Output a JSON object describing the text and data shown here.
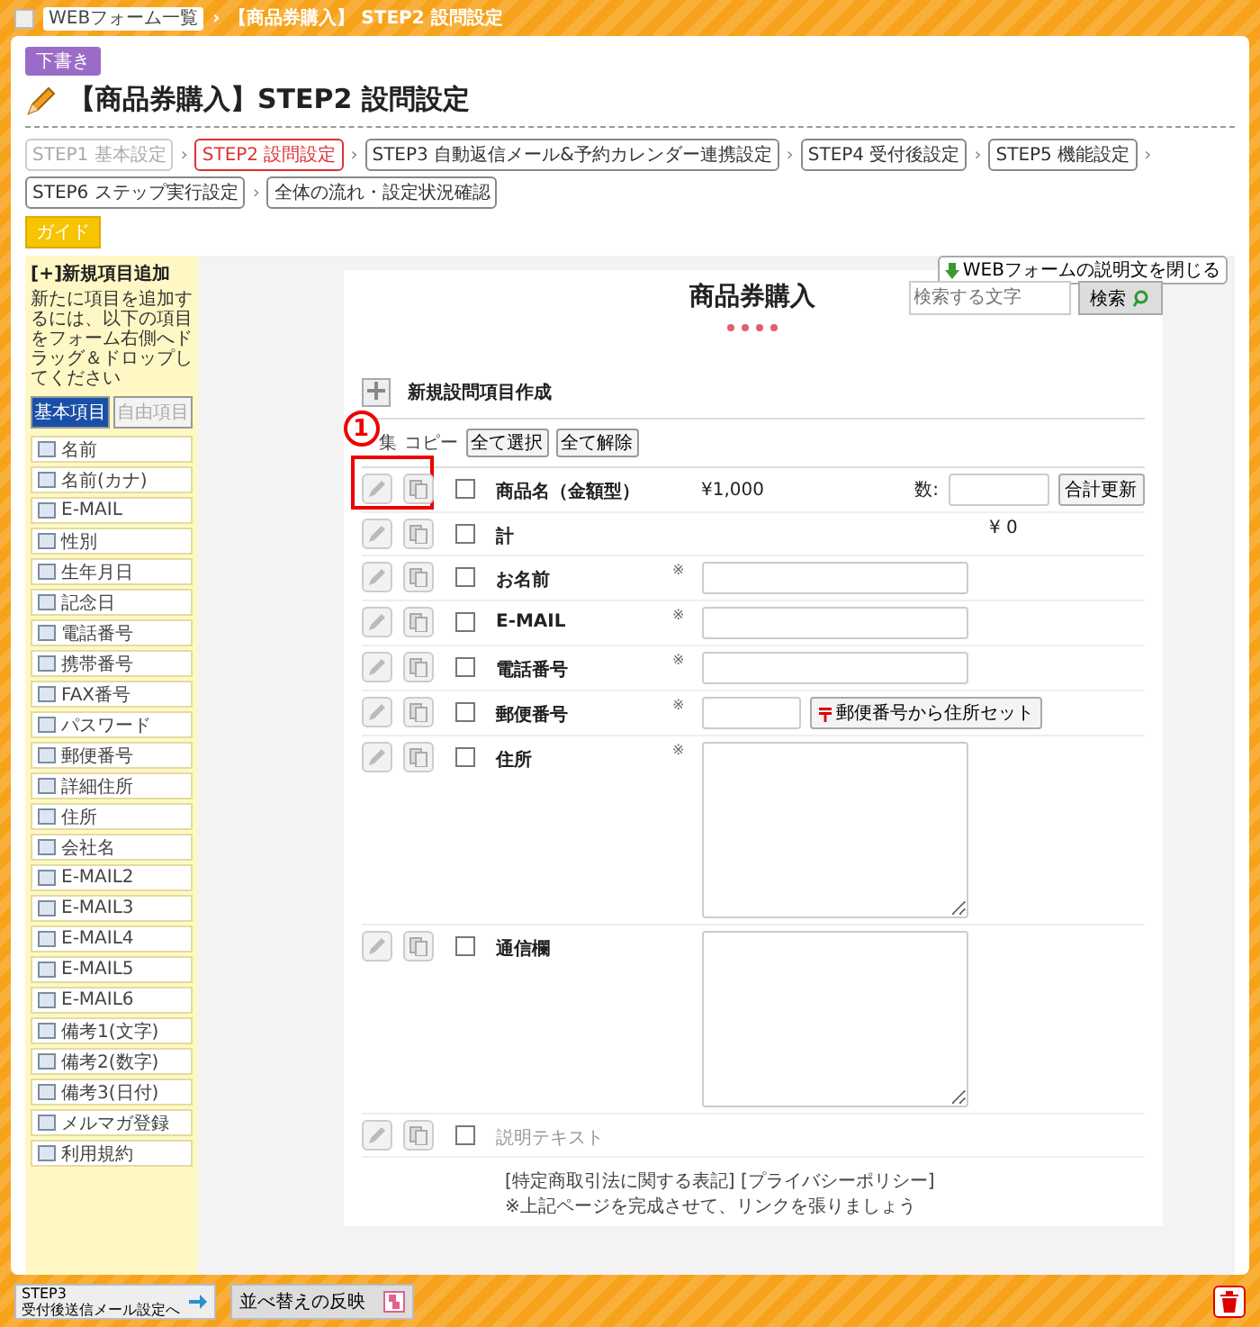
{
  "breadcrumb": {
    "home": "WEBフォーム一覧",
    "current": "【商品券購入】 STEP2 設問設定"
  },
  "separator": "›",
  "status_badge": "下書き",
  "title": "【商品券購入】STEP2 設問設定",
  "steps": [
    {
      "label": "STEP1 基本設定",
      "selected": false,
      "disabled": true
    },
    {
      "label": "STEP2 設問設定",
      "selected": true,
      "disabled": false
    },
    {
      "label": "STEP3 自動返信メール&予約カレンダー連携設定",
      "selected": false,
      "disabled": false
    },
    {
      "label": "STEP4 受付後設定",
      "selected": false,
      "disabled": false
    },
    {
      "label": "STEP5 機能設定",
      "selected": false,
      "disabled": false
    },
    {
      "label": "STEP6 ステップ実行設定",
      "selected": false,
      "disabled": false
    },
    {
      "label": "全体の流れ・設定状況確認",
      "selected": false,
      "disabled": false
    }
  ],
  "guide_badge": "ガイド",
  "sidebar": {
    "heading": "[+]新規項目追加",
    "hint": "新たに項目を追加するには、以下の項目をフォーム右側へドラッグ＆ドロップしてください",
    "tabs": [
      {
        "label": "基本項目",
        "selected": true
      },
      {
        "label": "自由項目",
        "selected": false
      }
    ],
    "items": [
      "名前",
      "名前(カナ)",
      "E-MAIL",
      "性別",
      "生年月日",
      "記念日",
      "電話番号",
      "携帯番号",
      "FAX番号",
      "パスワード",
      "郵便番号",
      "詳細住所",
      "住所",
      "会社名",
      "E-MAIL2",
      "E-MAIL3",
      "E-MAIL4",
      "E-MAIL5",
      "E-MAIL6",
      "備考1(文字)",
      "備考2(数字)",
      "備考3(日付)",
      "メルマガ登録",
      "利用規約"
    ]
  },
  "close_description_button": "WEBフォームの説明文を閉じる",
  "form": {
    "title": "商品券購入",
    "search": {
      "placeholder": "検索する文字",
      "button": "検索"
    },
    "new_item": "新規設問項目作成",
    "callout": "1",
    "header": {
      "edit": "集",
      "copy": "コピー",
      "select_all": "全て選択",
      "deselect_all": "全て解除"
    },
    "rows": [
      {
        "kind": "product",
        "label": "商品名（金額型）",
        "required": false,
        "checked": false,
        "price": "¥1,000",
        "qty_label": "数:",
        "button": "合計更新"
      },
      {
        "kind": "total",
        "label": "計",
        "required": false,
        "checked": false,
        "amount": "¥ 0"
      },
      {
        "kind": "input",
        "label": "お名前",
        "required": true,
        "checked": false
      },
      {
        "kind": "input",
        "label": "E-MAIL",
        "required": true,
        "checked": false
      },
      {
        "kind": "input",
        "label": "電話番号",
        "required": true,
        "checked": false
      },
      {
        "kind": "zip",
        "label": "郵便番号",
        "required": true,
        "checked": false,
        "button": "郵便番号から住所セット"
      },
      {
        "kind": "textarea",
        "label": "住所",
        "required": true,
        "checked": false
      },
      {
        "kind": "textarea",
        "label": "通信欄",
        "required": false,
        "checked": false
      },
      {
        "kind": "note",
        "label": "説明テキスト",
        "required": false,
        "checked": false
      }
    ],
    "required_mark": "※",
    "links": [
      "[特定商取引法に関する表記]",
      "[プライバシーポリシー]"
    ],
    "links_note": "※上記ページを完成させて、リンクを張りましょう"
  },
  "footer": {
    "next_button": {
      "step": "STEP3",
      "label": "受付後送信メール設定へ"
    },
    "apply_sort_button": "並べ替えの反映"
  }
}
